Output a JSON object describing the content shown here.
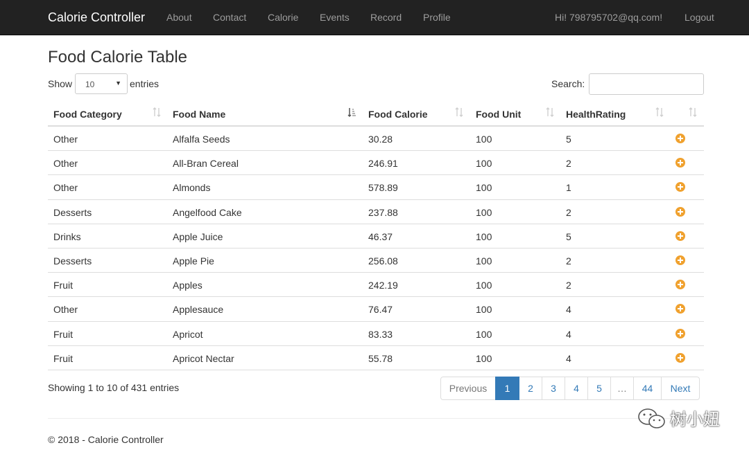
{
  "navbar": {
    "brand": "Calorie Controller",
    "items": [
      "About",
      "Contact",
      "Calorie",
      "Events",
      "Record",
      "Profile"
    ],
    "greeting": "Hi! 798795702@qq.com!",
    "logout": "Logout"
  },
  "page": {
    "title": "Food Calorie Table"
  },
  "length_control": {
    "show_label": "Show",
    "selected": "10",
    "entries_label": "entries"
  },
  "search": {
    "label": "Search:",
    "value": ""
  },
  "table": {
    "headers": [
      "Food Category",
      "Food Name",
      "Food Calorie",
      "Food Unit",
      "HealthRating"
    ],
    "rows": [
      [
        "Other",
        "Alfalfa Seeds",
        "30.28",
        "100",
        "5"
      ],
      [
        "Other",
        "All-Bran Cereal",
        "246.91",
        "100",
        "2"
      ],
      [
        "Other",
        "Almonds",
        "578.89",
        "100",
        "1"
      ],
      [
        "Desserts",
        "Angelfood Cake",
        "237.88",
        "100",
        "2"
      ],
      [
        "Drinks",
        "Apple Juice",
        "46.37",
        "100",
        "5"
      ],
      [
        "Desserts",
        "Apple Pie",
        "256.08",
        "100",
        "2"
      ],
      [
        "Fruit",
        "Apples",
        "242.19",
        "100",
        "2"
      ],
      [
        "Other",
        "Applesauce",
        "76.47",
        "100",
        "4"
      ],
      [
        "Fruit",
        "Apricot",
        "83.33",
        "100",
        "4"
      ],
      [
        "Fruit",
        "Apricot Nectar",
        "55.78",
        "100",
        "4"
      ]
    ],
    "row_action_icon": "plus-circle-icon",
    "sorted_column": "Food Name"
  },
  "info": "Showing 1 to 10 of 431 entries",
  "pagination": {
    "previous": "Previous",
    "pages": [
      "1",
      "2",
      "3",
      "4",
      "5",
      "…",
      "44"
    ],
    "active": "1",
    "next": "Next"
  },
  "footer": {
    "text": "© 2018 - Calorie Controller"
  },
  "watermark": {
    "text": "树小妞"
  },
  "colors": {
    "navbar_bg": "#222222",
    "accent": "#337ab7",
    "action_icon": "#f0a12e"
  }
}
